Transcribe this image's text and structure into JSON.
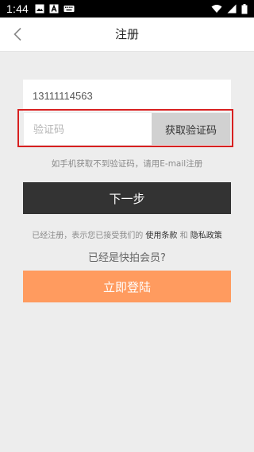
{
  "status_bar": {
    "time": "1:44",
    "left_icons": [
      "image-icon",
      "text-a-icon",
      "keyboard-icon"
    ],
    "right_icons": [
      "wifi-icon",
      "signal-icon",
      "battery-icon"
    ]
  },
  "nav": {
    "back_icon": "chevron-left-icon",
    "title": "注册"
  },
  "form": {
    "phone_value": "13111114563",
    "code_placeholder": "验证码",
    "get_code_label": "获取验证码",
    "email_hint": "如手机获取不到验证码，请用E-mail注册",
    "next_label": "下一步"
  },
  "terms": {
    "prefix": "已经注册，表示您已接受我们的 ",
    "terms_link": "使用条款",
    "conjunction": " 和 ",
    "privacy_link": "隐私政策"
  },
  "member": {
    "prompt": "已经是快拍会员?",
    "login_label": "立即登陆"
  },
  "colors": {
    "next_button": "#333333",
    "login_button": "#ff9b5f",
    "highlight_border": "#d82020",
    "get_code_button": "#d1d1d1"
  }
}
